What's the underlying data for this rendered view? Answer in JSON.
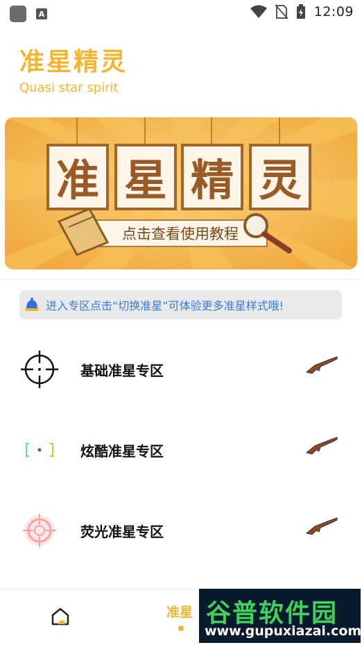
{
  "status_bar": {
    "time": "12:09",
    "notif_icon": "A"
  },
  "header": {
    "title": "准星精灵",
    "subtitle": "Quasi star spirit"
  },
  "banner": {
    "letters": [
      "准",
      "星",
      "精",
      "灵"
    ],
    "caption": "点击查看使用教程"
  },
  "notice": {
    "text": "进入专区点击“切换准星”可体验更多准星样式哦!"
  },
  "zones": [
    {
      "label": "基础准星专区",
      "icon": "crosshair-basic-icon"
    },
    {
      "label": "炫酷准星专区",
      "icon": "crosshair-cool-icon"
    },
    {
      "label": "荧光准星专区",
      "icon": "crosshair-neon-icon"
    }
  ],
  "bottom_nav": {
    "active_tab": "准星"
  },
  "watermark": {
    "big": "谷普软件园",
    "small": "www.gupuxiazai.com"
  },
  "colors": {
    "accent": "#f2b632",
    "notice_text": "#3a7be0"
  }
}
